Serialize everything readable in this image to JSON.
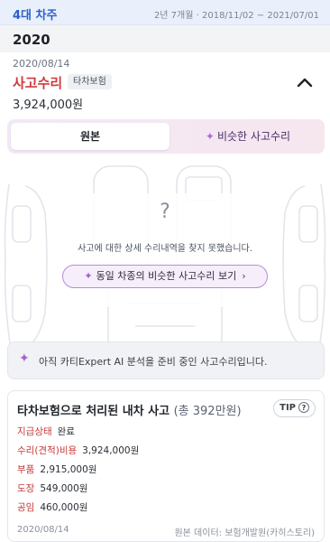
{
  "owner": {
    "title": "4대 차주",
    "period": "2년 7개월 · 2018/11/02 ~ 2021/07/01"
  },
  "year": "2020",
  "record": {
    "date": "2020/08/14",
    "title": "사고수리",
    "badge": "타차보험",
    "amount": "3,924,000원",
    "toggle_icon": "chevron-up-icon"
  },
  "tabs": {
    "original": "원본",
    "similar": "비슷한 사고수리",
    "similar_icon": "sparkle-icon"
  },
  "diagram": {
    "question": "?",
    "no_detail": "사고에 대한 상세 수리내역을 찾지 못했습니다.",
    "similar_button": "동일 차종의 비슷한 사고수리 보기",
    "similar_arrow": "›"
  },
  "ai_banner": {
    "icon": "sparkle-icon",
    "text": "아직 카티Expert AI 분석을 준비 중인 사고수리입니다."
  },
  "detail": {
    "title": "타차보험으로 처리된 내차 사고",
    "total": "(총 392만원)",
    "tip_label": "TIP",
    "tip_icon": "?",
    "rows": [
      {
        "label": "지급상태",
        "value": "완료"
      },
      {
        "label": "수리(견적)비용",
        "value": "3,924,000원"
      },
      {
        "label": "부품",
        "value": "2,915,000원"
      },
      {
        "label": "도장",
        "value": "549,000원"
      },
      {
        "label": "공임",
        "value": "460,000원"
      }
    ],
    "footer_date": "2020/08/14",
    "footer_source": "원본 데이터: 보험개발원(카히스토리)"
  },
  "colors": {
    "accent_blue": "#2b5fcc",
    "accent_red": "#d03a3a",
    "accent_purple": "#a55fd0"
  }
}
